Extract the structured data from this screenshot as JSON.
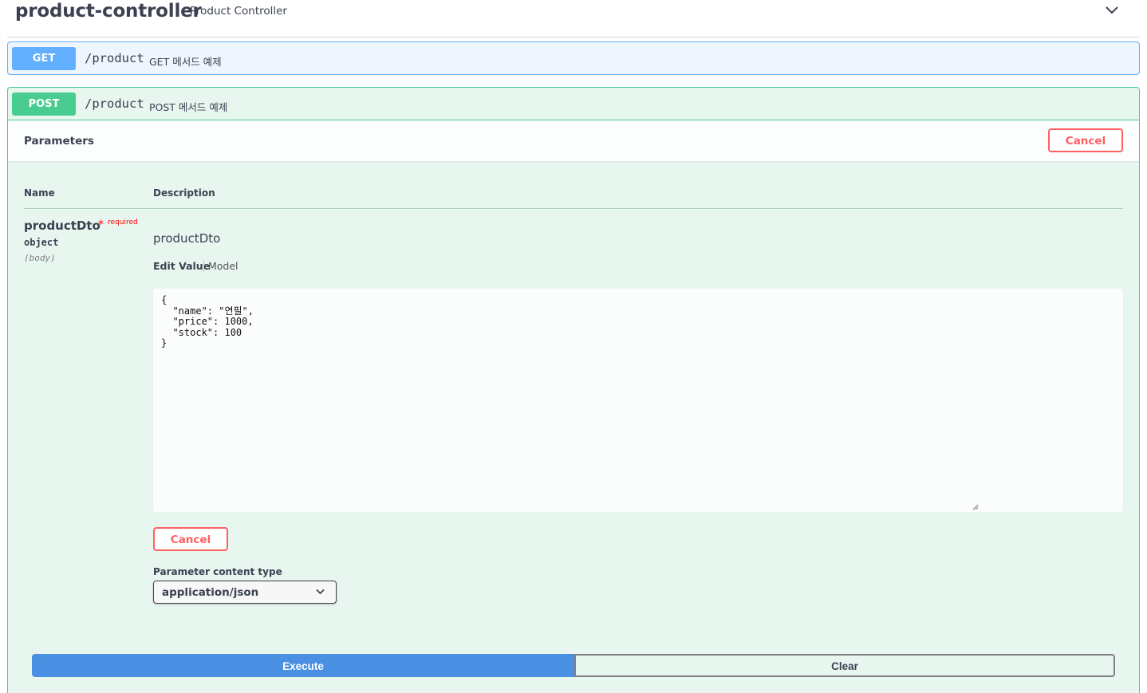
{
  "tag": {
    "name": "product-controller",
    "description": "Product Controller",
    "expand_icon": "chevron-down-icon"
  },
  "operations": {
    "get": {
      "method": "GET",
      "path": "/product",
      "summary": "GET 메서드 예제",
      "color": "#61affe"
    },
    "post": {
      "method": "POST",
      "path": "/product",
      "summary": "POST 메서드 예제",
      "color": "#49cc90"
    }
  },
  "parameters_panel": {
    "title": "Parameters",
    "cancel_label": "Cancel",
    "columns": {
      "name": "Name",
      "description": "Description"
    },
    "param": {
      "name": "productDto",
      "required_marker": "*",
      "required_label": "required",
      "type": "object",
      "in": "(body)",
      "description_name": "productDto",
      "tabs": {
        "edit_value": "Edit Value",
        "model": "Model"
      },
      "body_value": "{\n  \"name\": \"연필\",\n  \"price\": 1000,\n  \"stock\": 100\n}",
      "cancel_label": "Cancel"
    },
    "content_type": {
      "label": "Parameter content type",
      "selected": "application/json"
    }
  },
  "actions": {
    "execute_label": "Execute",
    "clear_label": "Clear"
  },
  "colors": {
    "cancel": "#ff6060",
    "execute": "#4990e2"
  }
}
